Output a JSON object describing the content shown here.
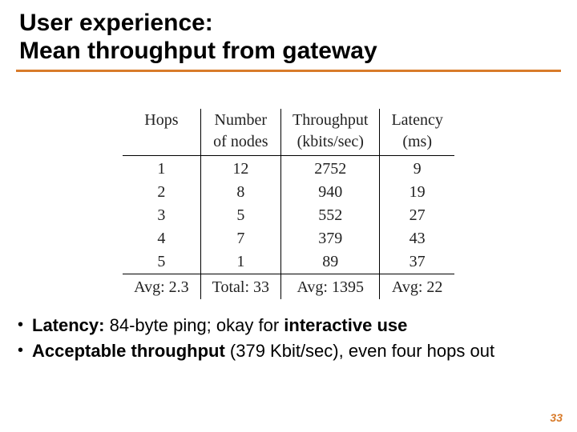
{
  "title": {
    "line1": "User experience:",
    "line2": "Mean throughput from gateway"
  },
  "table": {
    "headers": {
      "hops": "Hops",
      "nodes_l1": "Number",
      "nodes_l2": "of nodes",
      "tput_l1": "Throughput",
      "tput_l2": "(kbits/sec)",
      "lat_l1": "Latency",
      "lat_l2": "(ms)"
    },
    "rows": [
      {
        "hops": "1",
        "nodes": "12",
        "tput": "2752",
        "lat": "9"
      },
      {
        "hops": "2",
        "nodes": "8",
        "tput": "940",
        "lat": "19"
      },
      {
        "hops": "3",
        "nodes": "5",
        "tput": "552",
        "lat": "27"
      },
      {
        "hops": "4",
        "nodes": "7",
        "tput": "379",
        "lat": "43"
      },
      {
        "hops": "5",
        "nodes": "1",
        "tput": "89",
        "lat": "37"
      }
    ],
    "footer": {
      "hops": "Avg: 2.3",
      "nodes": "Total: 33",
      "tput": "Avg: 1395",
      "lat": "Avg: 22"
    }
  },
  "bullets": {
    "b1": {
      "strong_a": "Latency:",
      "mid": " 84-byte ping; okay for ",
      "strong_b": "interactive use"
    },
    "b2": {
      "strong_a": "Acceptable throughput",
      "rest": " (379 Kbit/sec), even four hops out"
    }
  },
  "page_number": "33",
  "chart_data": {
    "type": "table",
    "title": "User experience: Mean throughput from gateway",
    "columns": [
      "Hops",
      "Number of nodes",
      "Throughput (kbits/sec)",
      "Latency (ms)"
    ],
    "rows": [
      [
        1,
        12,
        2752,
        9
      ],
      [
        2,
        8,
        940,
        19
      ],
      [
        3,
        5,
        552,
        27
      ],
      [
        4,
        7,
        379,
        43
      ],
      [
        5,
        1,
        89,
        37
      ]
    ],
    "summary": {
      "Hops": "Avg: 2.3",
      "Number of nodes": "Total: 33",
      "Throughput (kbits/sec)": "Avg: 1395",
      "Latency (ms)": "Avg: 22"
    }
  }
}
